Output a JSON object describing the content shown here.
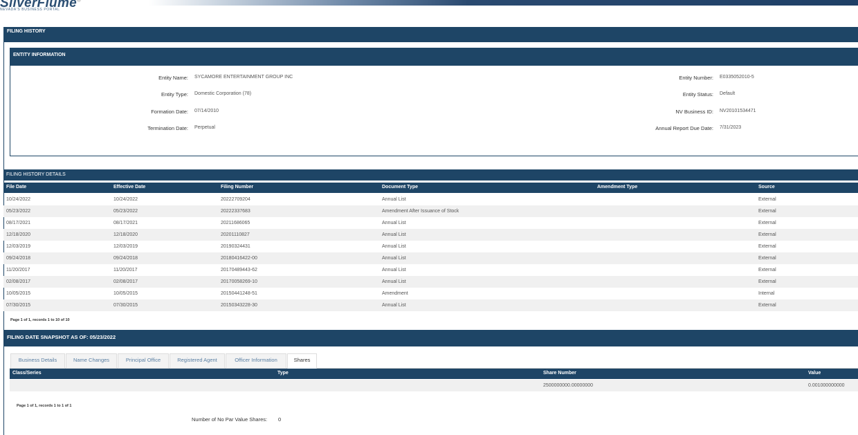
{
  "header": {
    "logo": "SilverFlume",
    "logo_sub": "NEVADA'S BUSINESS PORTAL"
  },
  "filing_history_title": "FILING HISTORY",
  "entity_info": {
    "title": "ENTITY INFORMATION",
    "labels": {
      "name": "Entity Name:",
      "type": "Entity Type:",
      "formation": "Formation Date:",
      "termination": "Termination Date:",
      "number": "Entity Number:",
      "status": "Entity Status:",
      "nvid": "NV Business ID:",
      "annual": "Annual Report Due Date:"
    },
    "values": {
      "name": "SYCAMORE ENTERTAINMENT GROUP INC",
      "type": "Domestic Corporation (78)",
      "formation": "07/14/2010",
      "termination": "Perpetual",
      "number": "E0335052010-5",
      "status": "Default",
      "nvid": "NV20101534471",
      "annual": "7/31/2023"
    }
  },
  "details": {
    "title": "FILING HISTORY DETAILS",
    "columns": [
      "File Date",
      "Effective Date",
      "Filing Number",
      "Document Type",
      "Amendment Type",
      "Source"
    ],
    "rows": [
      [
        "10/24/2022",
        "10/24/2022",
        "20222709204",
        "Annual List",
        "",
        "External"
      ],
      [
        "05/23/2022",
        "05/23/2022",
        "20222337683",
        "Amendment After Issuance of Stock",
        "",
        "External"
      ],
      [
        "08/17/2021",
        "08/17/2021",
        "20211686065",
        "Annual List",
        "",
        "External"
      ],
      [
        "12/18/2020",
        "12/18/2020",
        "20201110827",
        "Annual List",
        "",
        "External"
      ],
      [
        "12/03/2019",
        "12/03/2019",
        "20190324431",
        "Annual List",
        "",
        "External"
      ],
      [
        "09/24/2018",
        "09/24/2018",
        "20180416422-00",
        "Annual List",
        "",
        "External"
      ],
      [
        "11/20/2017",
        "11/20/2017",
        "20170489443-62",
        "Annual List",
        "",
        "External"
      ],
      [
        "02/08/2017",
        "02/08/2017",
        "20170058269-10",
        "Annual List",
        "",
        "External"
      ],
      [
        "10/05/2015",
        "10/05/2015",
        "20150441248-51",
        "Amendment",
        "",
        "Internal"
      ],
      [
        "07/30/2015",
        "07/30/2015",
        "20150343228-30",
        "Annual List",
        "",
        "External"
      ]
    ],
    "page_info": "Page 1 of 1, records 1 to 10 of 10"
  },
  "snapshot": {
    "title": "FILING DATE SNAPSHOT AS OF: 05/23/2022",
    "tabs": [
      "Business Details",
      "Name Changes",
      "Principal Office",
      "Registered Agent",
      "Officer Information",
      "Shares"
    ],
    "active_tab": "Shares",
    "columns": [
      "Class/Series",
      "Type",
      "Share Number",
      "Value"
    ],
    "rows": [
      [
        "",
        "",
        "2500000000.00000000",
        "0.001000000000"
      ]
    ],
    "page_info": "Page 1 of 1, records 1 to 1 of 1",
    "no_par_label": "Number of No Par Value Shares:",
    "no_par_value": "0"
  }
}
